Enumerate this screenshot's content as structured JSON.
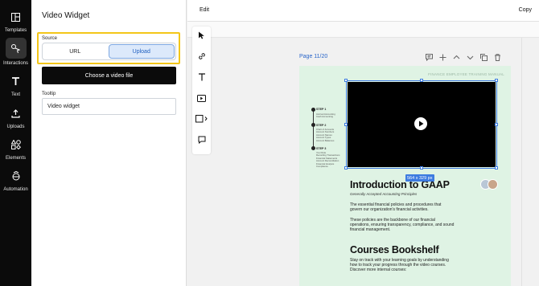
{
  "rail": {
    "items": [
      {
        "label": "Templates",
        "icon": "templates-icon"
      },
      {
        "label": "Interactions",
        "icon": "interactions-icon"
      },
      {
        "label": "Text",
        "icon": "text-icon"
      },
      {
        "label": "Uploads",
        "icon": "upload-icon"
      },
      {
        "label": "Elements",
        "icon": "elements-icon"
      },
      {
        "label": "Automation",
        "icon": "automation-icon"
      }
    ]
  },
  "panel": {
    "title": "Video Widget",
    "source_label": "Source",
    "source_options": [
      "URL",
      "Upload"
    ],
    "selected_source": "Upload",
    "choose_button": "Choose a video file",
    "tooltip_label": "Tooltip",
    "tooltip_value": "Video widget"
  },
  "topbar": {
    "edit": "Edit",
    "copy": "Copy"
  },
  "canvas": {
    "page_label": "Page 11/20",
    "size_badge": "564 x 329 px"
  },
  "doc": {
    "header": "FINANCE EMPLOYEE TRAINING MANUAL",
    "steps": [
      {
        "title": "STEP 1",
        "items": "Accrual Accounting\nCash Accounting"
      },
      {
        "title": "STEP 2",
        "items": "Chart of Accounts\nAccount Numbers\nAccount Names\nAccount Types\nAccount Balances"
      },
      {
        "title": "STEP 3",
        "items": "Your Role\nRecording Transactions\nFinancial Statements\nAccount Reconciliation\nFinancial Analysis\nCompliance"
      }
    ],
    "intro_title": "Introduction to GAAP",
    "intro_subtitle": "Generally Accepted Accounting Principles",
    "para1": "The essential financial policies and procedures that govern our organization's financial activities.",
    "para2": "These policies are the backbone of our financial operations, ensuring transparency, compliance, and sound financial management.",
    "courses_title": "Courses Bookshelf",
    "para3": "Stay on track with your learning goals by understanding how to track your progress through the video courses. Discover more internal courses:"
  },
  "colors": {
    "accent": "#3d7be0",
    "highlight": "#f3c619",
    "doc_bg": "#dff3e4"
  }
}
